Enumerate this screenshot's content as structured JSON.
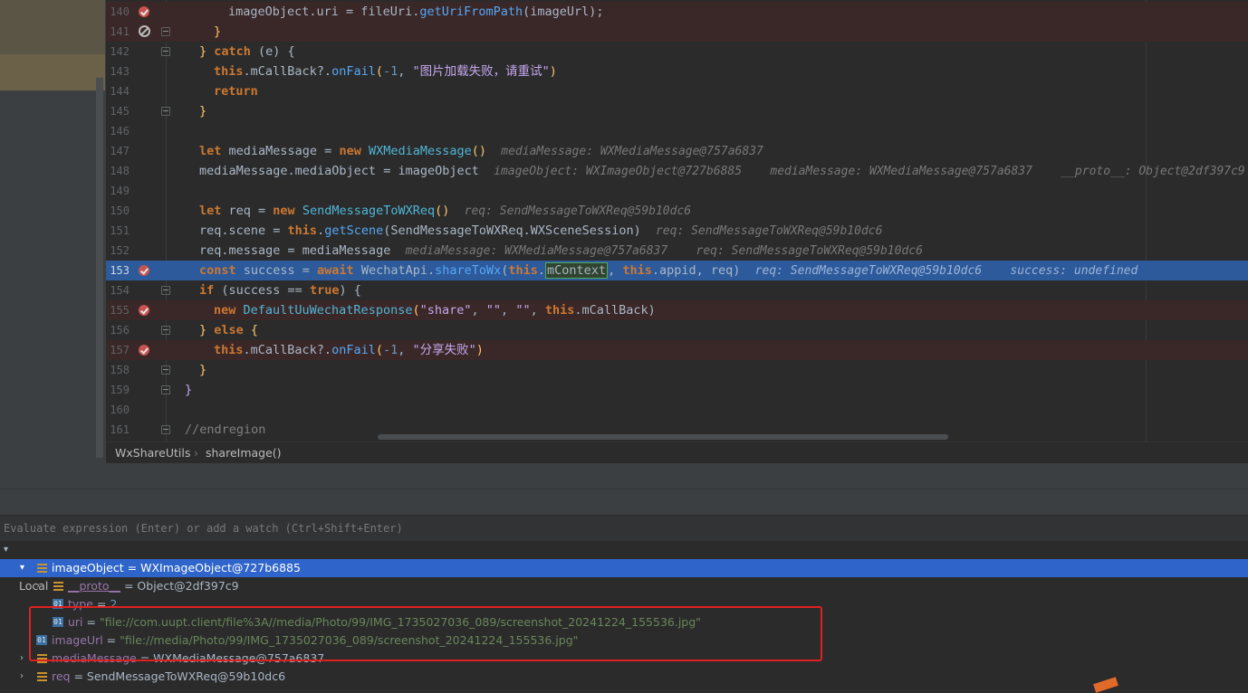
{
  "editor": {
    "lines": [
      {
        "n": "140",
        "state": "err",
        "marker": "breakpoint",
        "fold": false
      },
      {
        "n": "141",
        "state": "err",
        "marker": "disabled",
        "fold": true
      },
      {
        "n": "142",
        "state": "",
        "marker": "",
        "fold": true
      },
      {
        "n": "143",
        "state": "",
        "marker": "",
        "fold": false
      },
      {
        "n": "144",
        "state": "",
        "marker": "",
        "fold": false
      },
      {
        "n": "145",
        "state": "",
        "marker": "",
        "fold": true
      },
      {
        "n": "146",
        "state": "",
        "marker": "",
        "fold": false
      },
      {
        "n": "147",
        "state": "",
        "marker": "",
        "fold": false
      },
      {
        "n": "148",
        "state": "",
        "marker": "",
        "fold": false
      },
      {
        "n": "149",
        "state": "",
        "marker": "",
        "fold": false
      },
      {
        "n": "150",
        "state": "",
        "marker": "",
        "fold": false
      },
      {
        "n": "151",
        "state": "",
        "marker": "",
        "fold": false
      },
      {
        "n": "152",
        "state": "",
        "marker": "",
        "fold": false
      },
      {
        "n": "153",
        "state": "cur",
        "marker": "breakpoint",
        "fold": false
      },
      {
        "n": "154",
        "state": "",
        "marker": "",
        "fold": true
      },
      {
        "n": "155",
        "state": "err",
        "marker": "breakpoint",
        "fold": false
      },
      {
        "n": "156",
        "state": "",
        "marker": "",
        "fold": true
      },
      {
        "n": "157",
        "state": "err",
        "marker": "breakpoint",
        "fold": false
      },
      {
        "n": "158",
        "state": "",
        "marker": "",
        "fold": true
      },
      {
        "n": "159",
        "state": "",
        "marker": "",
        "fold": true
      },
      {
        "n": "160",
        "state": "",
        "marker": "",
        "fold": false
      },
      {
        "n": "161",
        "state": "",
        "marker": "",
        "fold": true
      }
    ],
    "t": {
      "l140_a": "imageObject.uri = fileUri.",
      "l140_m": "getUriFromPath",
      "l140_b": "(imageUrl);",
      "l141": "}",
      "l142_a": "} ",
      "l142_k": "catch",
      "l142_b": " (e) {",
      "l143_this": "this",
      "l143_a": ".mCallBack?.",
      "l143_m": "onFail",
      "l143_b": "(",
      "l143_n": "-1",
      "l143_c": ", ",
      "l143_s": "\"图片加载失败，请重试\"",
      "l143_d": ")",
      "l144": "return",
      "l145": "}",
      "l147_let": "let",
      "l147_a": " mediaMessage = ",
      "l147_new": "new",
      "l147_cls": " WXMediaMessage",
      "l147_b": "()",
      "l147_hint": "mediaMessage: WXMediaMessage@757a6837",
      "l148_a": "mediaMessage.mediaObject = imageObject",
      "l148_hint": "imageObject: WXImageObject@727b6885    mediaMessage: WXMediaMessage@757a6837    __proto__: Object@2df397c9",
      "l150_let": "let",
      "l150_a": " req = ",
      "l150_new": "new",
      "l150_cls": " SendMessageToWXReq",
      "l150_b": "()",
      "l150_hint": "req: SendMessageToWXReq@59b10dc6",
      "l151_a": "req.scene = ",
      "l151_this": "this",
      "l151_b": ".",
      "l151_m": "getScene",
      "l151_c": "(SendMessageToWXReq.WXSceneSession)",
      "l151_hint": "req: SendMessageToWXReq@59b10dc6",
      "l152_a": "req.message = mediaMessage",
      "l152_hint": "mediaMessage: WXMediaMessage@757a6837    req: SendMessageToWXReq@59b10dc6",
      "l153_const": "const",
      "l153_a": " success = ",
      "l153_await": "await",
      "l153_b": " WechatApi.",
      "l153_m": "shareToWx",
      "l153_c": "(",
      "l153_this1": "this",
      ".": ".",
      "l153_ctx": "mContext",
      "l153_d": ", ",
      "l153_this2": "this",
      "l153_e": ".appid, req)",
      "l153_hint": "req: SendMessageToWXReq@59b10dc6    success: undefined",
      "l154_if": "if",
      "l154_a": " (success == ",
      "l154_true": "true",
      "l154_b": ") {",
      "l155_new": "new",
      "l155_cls": " DefaultUuWechatResponse",
      "l155_a": "(",
      "l155_s1": "\"share\"",
      "l155_b": ", ",
      "l155_s2": "\"\"",
      "l155_c": ", ",
      "l155_s3": "\"\"",
      "l155_d": ", ",
      "l155_this": "this",
      "l155_e": ".mCallBack)",
      "l156_a": "} ",
      "l156_else": "else",
      "l156_b": " {",
      "l157_this": "this",
      "l157_a": ".mCallBack?.",
      "l157_m": "onFail",
      "l157_b": "(",
      "l157_n": "-1",
      "l157_c": ", ",
      "l157_s": "\"分享失败\"",
      "l157_d": ")",
      "l158": "}",
      "l159": "}",
      "l161": "//endregion"
    }
  },
  "breadcrumb": {
    "class_name": "WxShareUtils",
    "separator": "›",
    "method_name": "shareImage()"
  },
  "evaluate": {
    "placeholder": "Evaluate expression (Enter) or add a watch (Ctrl+Shift+Enter)"
  },
  "variables": {
    "local_label": "Local",
    "image_object": {
      "name": "imageObject",
      "eq": " = ",
      "value": "WXImageObject@727b6885"
    },
    "proto": {
      "name": "__proto__",
      "eq": " = ",
      "value": "Object@2df397c9"
    },
    "type": {
      "name": "type",
      "eq": " = ",
      "value": "2"
    },
    "uri": {
      "name": "uri",
      "eq": " = ",
      "value": "\"file://com.uupt.client/file%3A//media/Photo/99/IMG_1735027036_089/screenshot_20241224_155536.jpg\""
    },
    "image_url": {
      "name": "imageUrl",
      "eq": " = ",
      "value": "\"file://media/Photo/99/IMG_1735027036_089/screenshot_20241224_155536.jpg\""
    },
    "media_message": {
      "name": "mediaMessage",
      "eq": " = ",
      "value": "WXMediaMessage@757a6837"
    },
    "req": {
      "name": "req",
      "eq": " = ",
      "value": "SendMessageToWXReq@59b10dc6"
    },
    "icon_01": "01"
  }
}
